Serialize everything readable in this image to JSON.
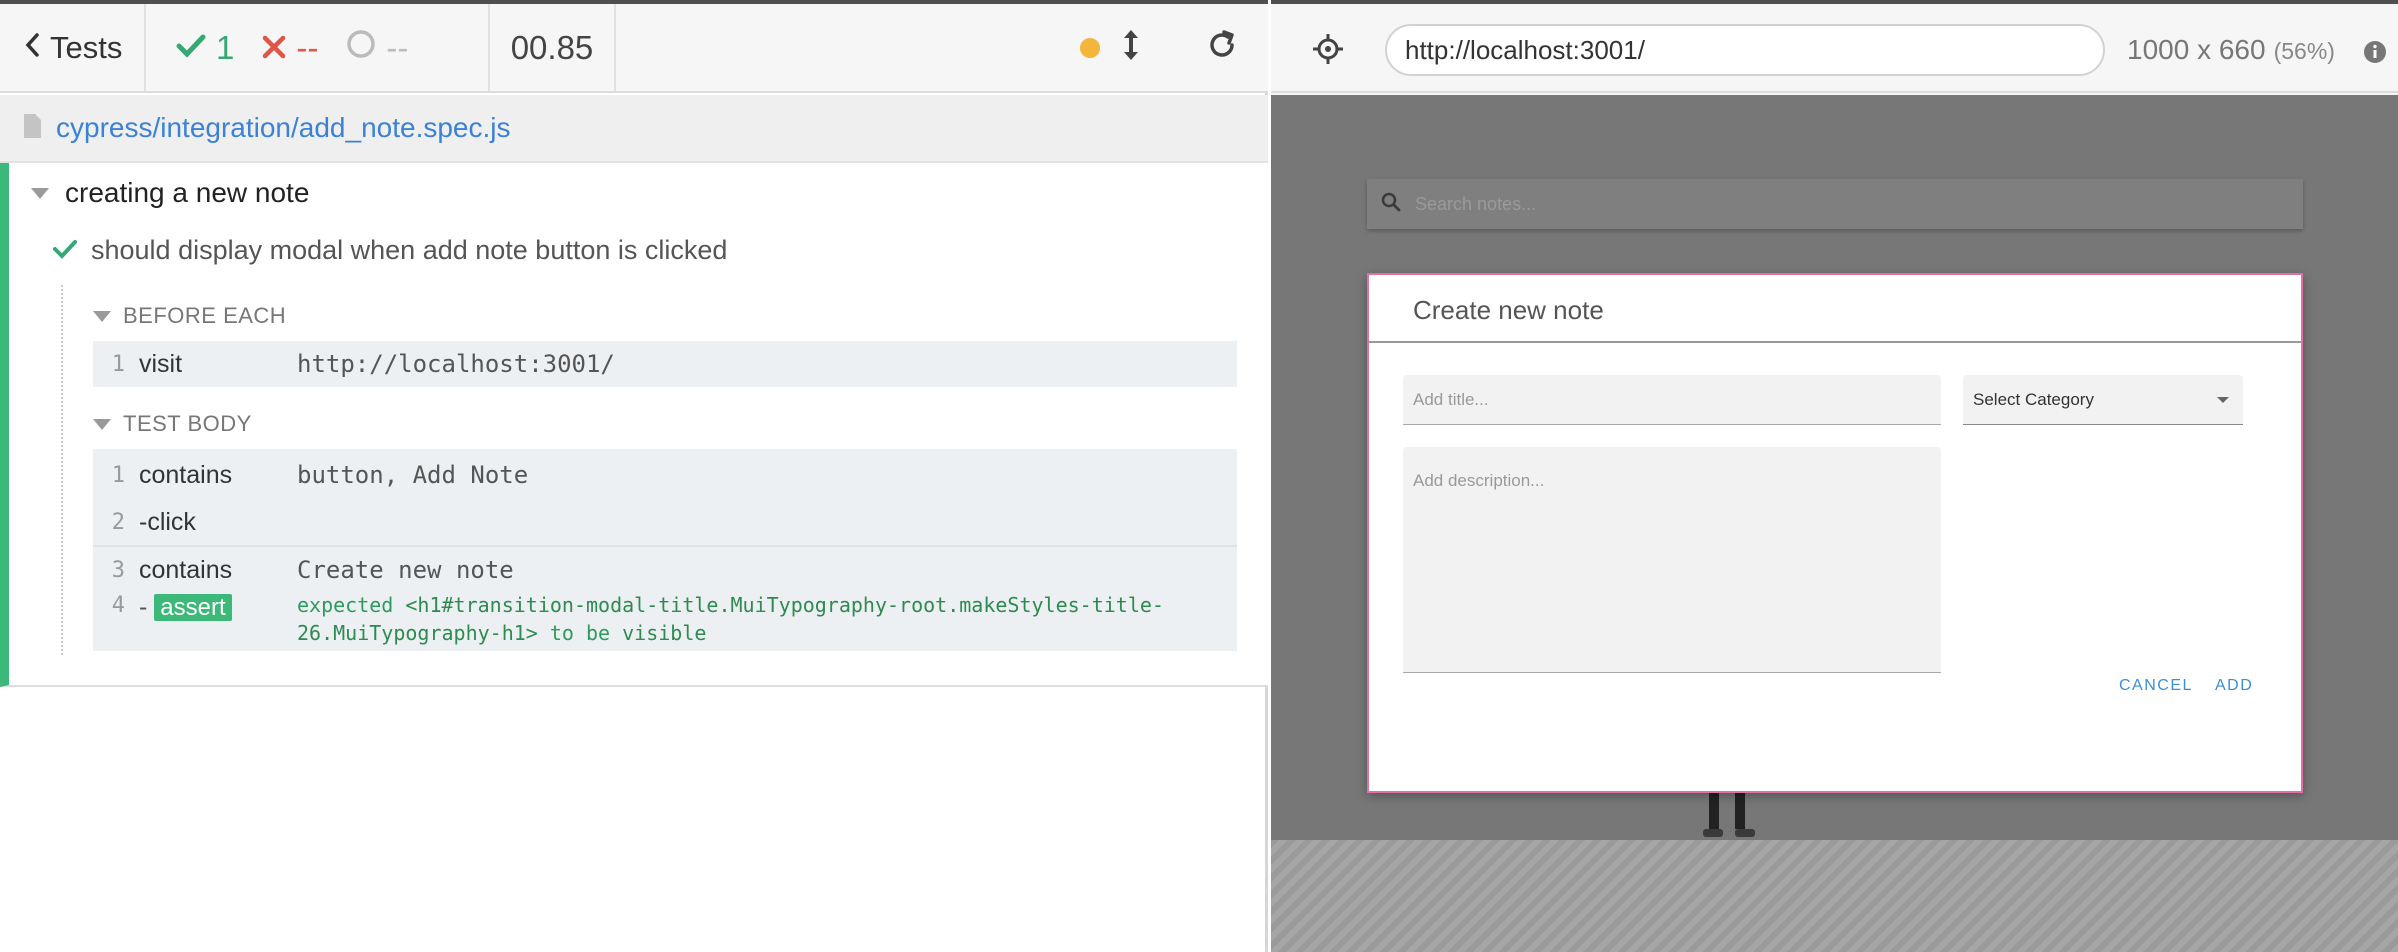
{
  "reporter": {
    "tests_label": "Tests",
    "passed": "1",
    "failed": "--",
    "pending": "--",
    "duration": "00.85",
    "spec_path": "cypress/integration/add_note.spec.js"
  },
  "suite": {
    "title": "creating a new note",
    "test_title": "should display modal when add note button is clicked",
    "before_each_label": "BEFORE EACH",
    "test_body_label": "TEST BODY",
    "before_each_commands": [
      {
        "num": "1",
        "name": "visit",
        "message": "http://localhost:3001/"
      }
    ],
    "test_body_commands": [
      {
        "num": "1",
        "name": "contains",
        "message": "button, Add Note"
      },
      {
        "num": "2",
        "name": "-click",
        "message": ""
      },
      {
        "num": "3",
        "name": "contains",
        "message": "Create new note"
      },
      {
        "num": "4",
        "name": "assert",
        "message_prefix": "expected",
        "message_subject": "<h1#transition-modal-title.MuiTypography-root.makeStyles-title-26.MuiTypography-h1>",
        "message_mid": "to be",
        "message_suffix": "visible"
      }
    ]
  },
  "preview": {
    "url": "http://localhost:3001/",
    "viewport": "1000 x 660",
    "scale": "(56%)",
    "search_placeholder": "Search notes...",
    "modal": {
      "title": "Create new note",
      "title_placeholder": "Add title...",
      "description_placeholder": "Add description...",
      "category_value": "Select Category",
      "cancel_label": "CANCEL",
      "add_label": "ADD"
    }
  },
  "colors": {
    "pass": "#36a874",
    "fail": "#e05545",
    "link": "#3b82d6",
    "indicator": "#f4b63a",
    "modal_border": "#e070a8"
  },
  "icons": [
    "chevron-left-icon",
    "check-icon",
    "x-icon",
    "circle-pending-icon",
    "status-dot-icon",
    "resize-icon",
    "reload-icon",
    "file-icon",
    "crosshair-icon",
    "info-icon",
    "search-icon",
    "dropdown-caret-icon"
  ]
}
